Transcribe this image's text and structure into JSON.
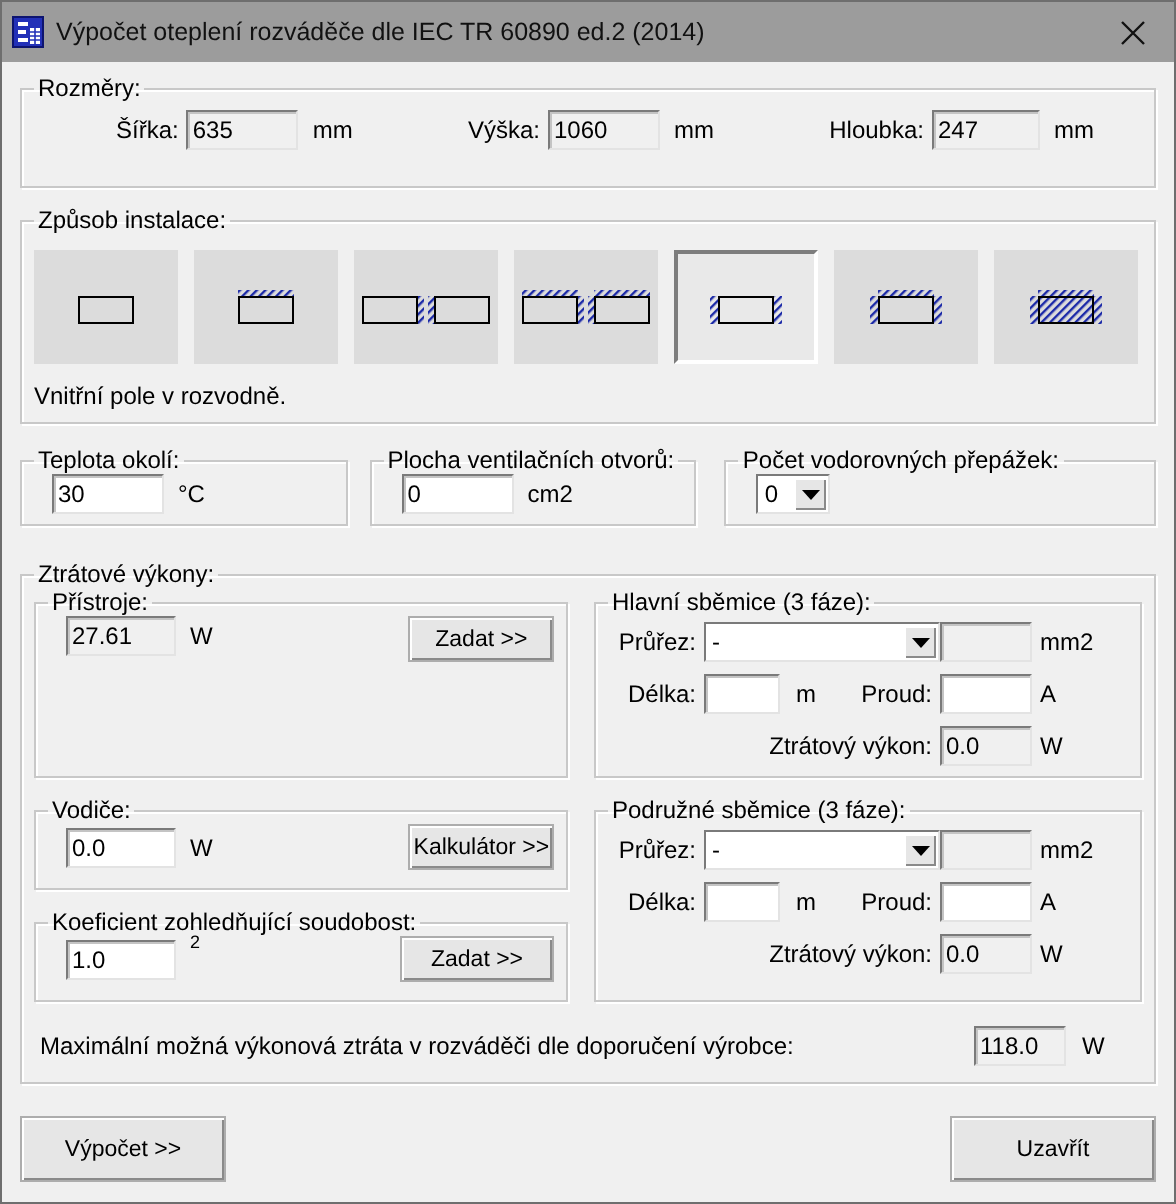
{
  "window": {
    "title": "Výpočet oteplení rozváděče dle IEC TR 60890 ed.2 (2014)"
  },
  "dimensions": {
    "legend": "Rozměry:",
    "fields": [
      {
        "label": "Šířka:",
        "value": "635",
        "unit": "mm",
        "readonly": true
      },
      {
        "label": "Výška:",
        "value": "1060",
        "unit": "mm",
        "readonly": true
      },
      {
        "label": "Hloubka:",
        "value": "247",
        "unit": "mm",
        "readonly": true
      }
    ]
  },
  "installation": {
    "legend": "Způsob instalace:",
    "options": [
      {
        "kind": "single",
        "selected": false
      },
      {
        "kind": "single-top",
        "selected": false
      },
      {
        "kind": "pair-inner",
        "selected": false
      },
      {
        "kind": "pair-top-inner",
        "selected": false
      },
      {
        "kind": "sides",
        "selected": true
      },
      {
        "kind": "top-sides",
        "selected": false
      },
      {
        "kind": "enclosed",
        "selected": false
      }
    ],
    "description": "Vnitřní pole v rozvodně."
  },
  "ambient": {
    "legend": "Teplota okolí:",
    "value": "30",
    "unit": "°C",
    "readonly": false
  },
  "ventilation": {
    "legend": "Plocha ventilačních otvorů:",
    "value": "0",
    "unit": "cm2",
    "readonly": false
  },
  "partitions": {
    "legend": "Počet vodorovných přepážek:",
    "value": "0"
  },
  "losses": {
    "legend": "Ztrátové výkony:",
    "devices": {
      "legend": "Přístroje:",
      "value": "27.61",
      "unit": "W",
      "readonly": true,
      "button": "Zadat >>"
    },
    "conductors": {
      "legend": "Vodiče:",
      "value": "0.0",
      "unit": "W",
      "readonly": false,
      "button": "Kalkulátor >>"
    },
    "coefficient": {
      "legend": "Koeficient zohledňující soudobost:",
      "value": "1.0",
      "unit": "2",
      "readonly": false,
      "button": "Zadat >>"
    },
    "busbars": [
      {
        "legend": "Hlavní sběmice (3 fáze):",
        "section_label": "Průřez:",
        "section_value": "-",
        "area_unit": "mm2",
        "length_label": "Délka:",
        "length_unit": "m",
        "current_label": "Proud:",
        "current_unit": "A",
        "loss_label": "Ztrátový výkon:",
        "loss_value": "0.0",
        "loss_unit": "W"
      },
      {
        "legend": "Podružné sběmice (3 fáze):",
        "section_label": "Průřez:",
        "section_value": "-",
        "area_unit": "mm2",
        "length_label": "Délka:",
        "length_unit": "m",
        "current_label": "Proud:",
        "current_unit": "A",
        "loss_label": "Ztrátový výkon:",
        "loss_value": "0.0",
        "loss_unit": "W"
      }
    ],
    "max_loss": {
      "label": "Maximální možná výkonová ztráta v rozváděči dle doporučení výrobce:",
      "value": "118.0",
      "unit": "W"
    }
  },
  "buttons": [
    "Výpočet >>",
    "Uzavřít"
  ]
}
